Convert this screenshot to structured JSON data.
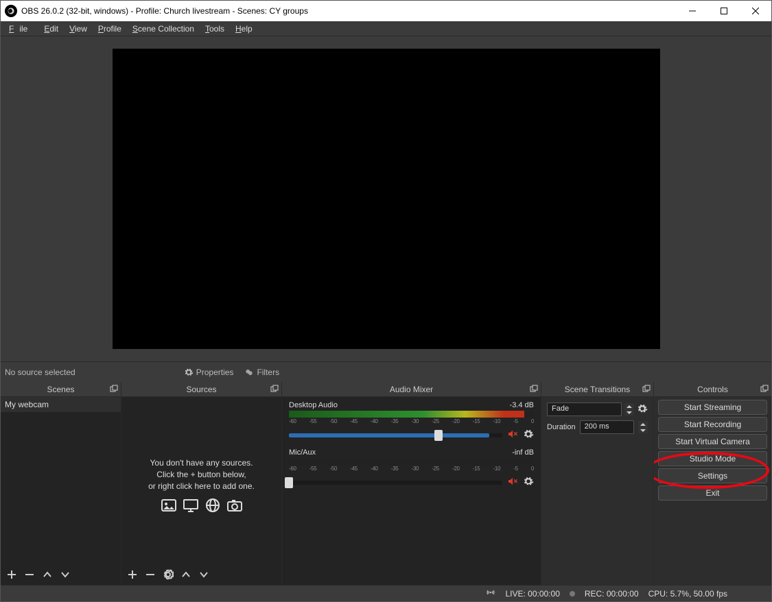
{
  "window": {
    "title": "OBS 26.0.2 (32-bit, windows) - Profile: Church livestream - Scenes: CY groups"
  },
  "menu": {
    "file": "File",
    "edit": "Edit",
    "view": "View",
    "profile": "Profile",
    "scene_collection": "Scene Collection",
    "tools": "Tools",
    "help": "Help"
  },
  "sourcebar": {
    "no_source": "No source selected",
    "properties": "Properties",
    "filters": "Filters"
  },
  "docks": {
    "scenes_title": "Scenes",
    "sources_title": "Sources",
    "mixer_title": "Audio Mixer",
    "transitions_title": "Scene Transitions",
    "controls_title": "Controls"
  },
  "scenes": {
    "items": [
      "My webcam"
    ]
  },
  "sources": {
    "empty1": "You don't have any sources.",
    "empty2": "Click the + button below,",
    "empty3": "or right click here to add one."
  },
  "mixer": {
    "scale": [
      "-60",
      "-55",
      "-50",
      "-45",
      "-40",
      "-35",
      "-30",
      "-25",
      "-20",
      "-15",
      "-10",
      "-5",
      "0"
    ],
    "channels": [
      {
        "name": "Desktop Audio",
        "db": "-3.4 dB",
        "fill_pct": 94,
        "thumb_pct": 70,
        "meter_mask_pct": 4
      },
      {
        "name": "Mic/Aux",
        "db": "-inf dB",
        "fill_pct": 0,
        "thumb_pct": 0,
        "meter_mask_pct": 100
      }
    ]
  },
  "transitions": {
    "selected": "Fade",
    "duration_label": "Duration",
    "duration_value": "200 ms"
  },
  "controls": {
    "streaming": "Start Streaming",
    "recording": "Start Recording",
    "virtualcam": "Start Virtual Camera",
    "studio": "Studio Mode",
    "settings": "Settings",
    "exit": "Exit"
  },
  "status": {
    "live": "LIVE: 00:00:00",
    "rec": "REC: 00:00:00",
    "cpu": "CPU: 5.7%, 50.00 fps"
  }
}
